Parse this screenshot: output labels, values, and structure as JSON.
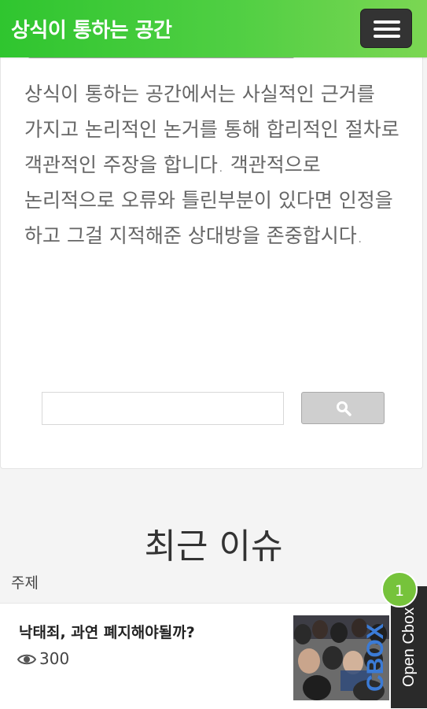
{
  "header": {
    "site_title": "상식이 통하는 공간",
    "menu_icon": "hamburger-icon"
  },
  "intro": {
    "paragraph": "상식이 통하는 공간에서는 사실적인 근거를 가지고 논리적인 논거를 통해 합리적인 절차로 객관적인 주장을 합니다. 객관적으로 논리적으로 오류와 틀린부분이 있다면 인정을 하고 그걸 지적해준 상대방을 존중합시다."
  },
  "search": {
    "input_value": "",
    "button_icon": "search-icon"
  },
  "recent": {
    "section_title": "최근 이슈",
    "topic_label": "주제",
    "items": [
      {
        "title": "낙태죄, 과연 폐지해야될까?",
        "views": "300",
        "views_icon": "eye-icon",
        "thumb_overlay": "CBOX"
      }
    ]
  },
  "cbox": {
    "label": "Open Cbox",
    "badge_count": "1"
  },
  "colors": {
    "header_green_start": "#2fc52f",
    "header_green_end": "#7bd653",
    "badge_green": "#76c33b",
    "menu_button_dark": "#333333"
  }
}
